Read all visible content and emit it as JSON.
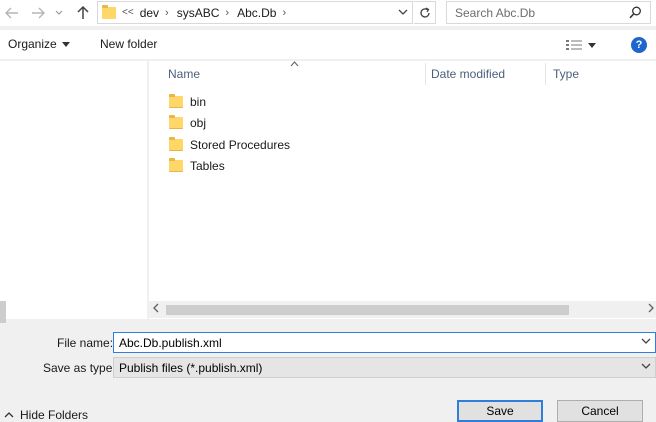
{
  "address_bar": {
    "crumbs": [
      "<<",
      "dev",
      "sysABC",
      "Abc.Db"
    ],
    "search_placeholder": "Search Abc.Db"
  },
  "toolbar": {
    "organize_label": "Organize",
    "new_folder_label": "New folder"
  },
  "columns": {
    "name": "Name",
    "date_modified": "Date modified",
    "type": "Type"
  },
  "items": [
    {
      "label": "bin"
    },
    {
      "label": "obj"
    },
    {
      "label": "Stored Procedures"
    },
    {
      "label": "Tables"
    }
  ],
  "form": {
    "file_name_label": "File name:",
    "file_name_value": "Abc.Db.publish.xml",
    "save_as_type_label": "Save as type:",
    "save_as_type_value": "Publish files (*.publish.xml)"
  },
  "footer": {
    "hide_folders_label": "Hide Folders",
    "save_label": "Save",
    "cancel_label": "Cancel"
  },
  "colors": {
    "accent": "#2f7ed8",
    "folder": "#ffd768",
    "help": "#1e66cc"
  }
}
